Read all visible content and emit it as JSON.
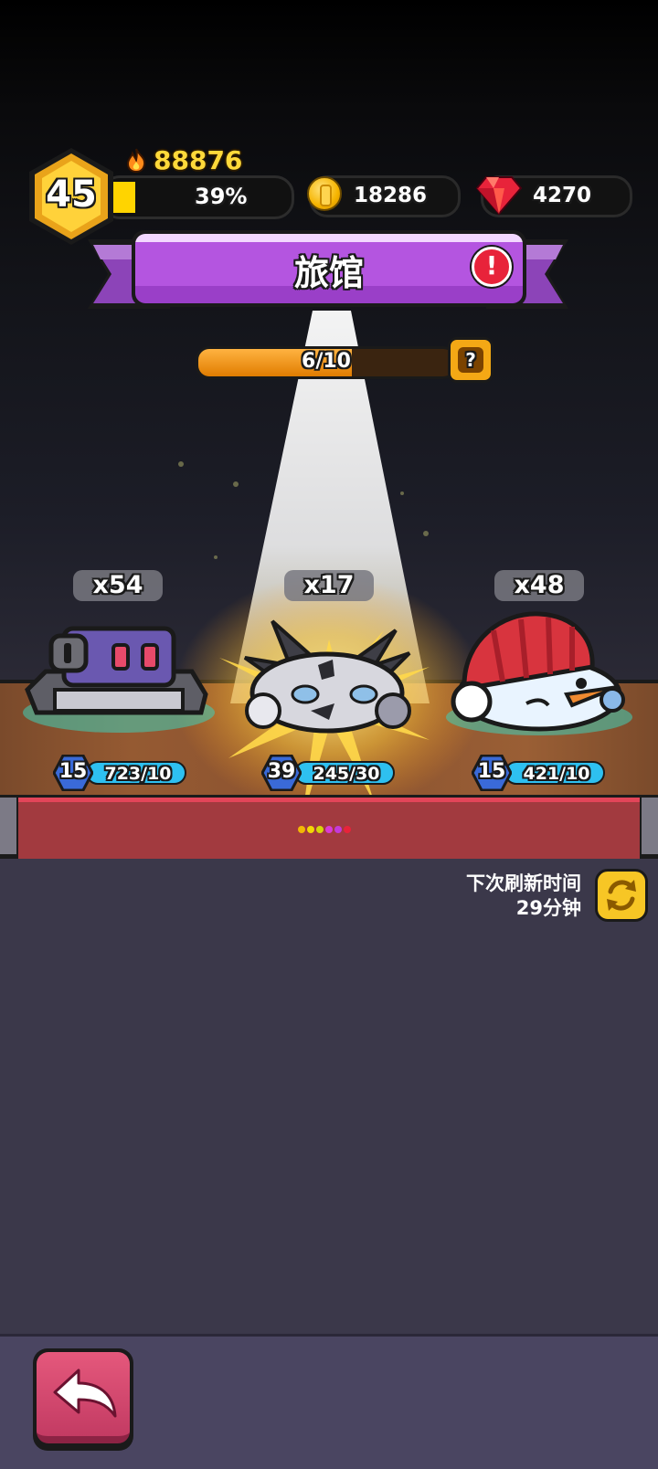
{
  "player": {
    "level": "45",
    "power": "88876",
    "xp_percent_label": "39%",
    "xp_fraction": 0.39
  },
  "resources": {
    "coins": "18286",
    "gems": "4270"
  },
  "title": {
    "label": "旅馆",
    "alert_symbol": "!"
  },
  "progress": {
    "label": "6/10",
    "current": 6,
    "total": 10,
    "help_symbol": "?"
  },
  "heroes": [
    {
      "count": "x54",
      "level": "15",
      "shards": "723/10",
      "icon": "robot-tank-hero-icon"
    },
    {
      "count": "x17",
      "level": "39",
      "shards": "245/30",
      "icon": "spiky-metal-slime-hero-icon"
    },
    {
      "count": "x48",
      "level": "15",
      "shards": "421/10",
      "icon": "snowman-hero-icon"
    }
  ],
  "page_dots": [
    "#f2b705",
    "#f2d705",
    "#d6d60a",
    "#d93ad9",
    "#c43ad9",
    "#e8233a"
  ],
  "refresh": {
    "line1": "下次刷新时间",
    "line2": "29分钟"
  },
  "colors": {
    "xp_fill": "#ffd400",
    "title_purple": "#b455e0",
    "rail_red": "#a23a3f",
    "back_button": "#d04a70"
  },
  "icons": {
    "power": "flame-icon",
    "coin": "coin-icon",
    "gem": "red-gem-icon",
    "refresh": "refresh-icon",
    "back": "back-arrow-icon"
  }
}
